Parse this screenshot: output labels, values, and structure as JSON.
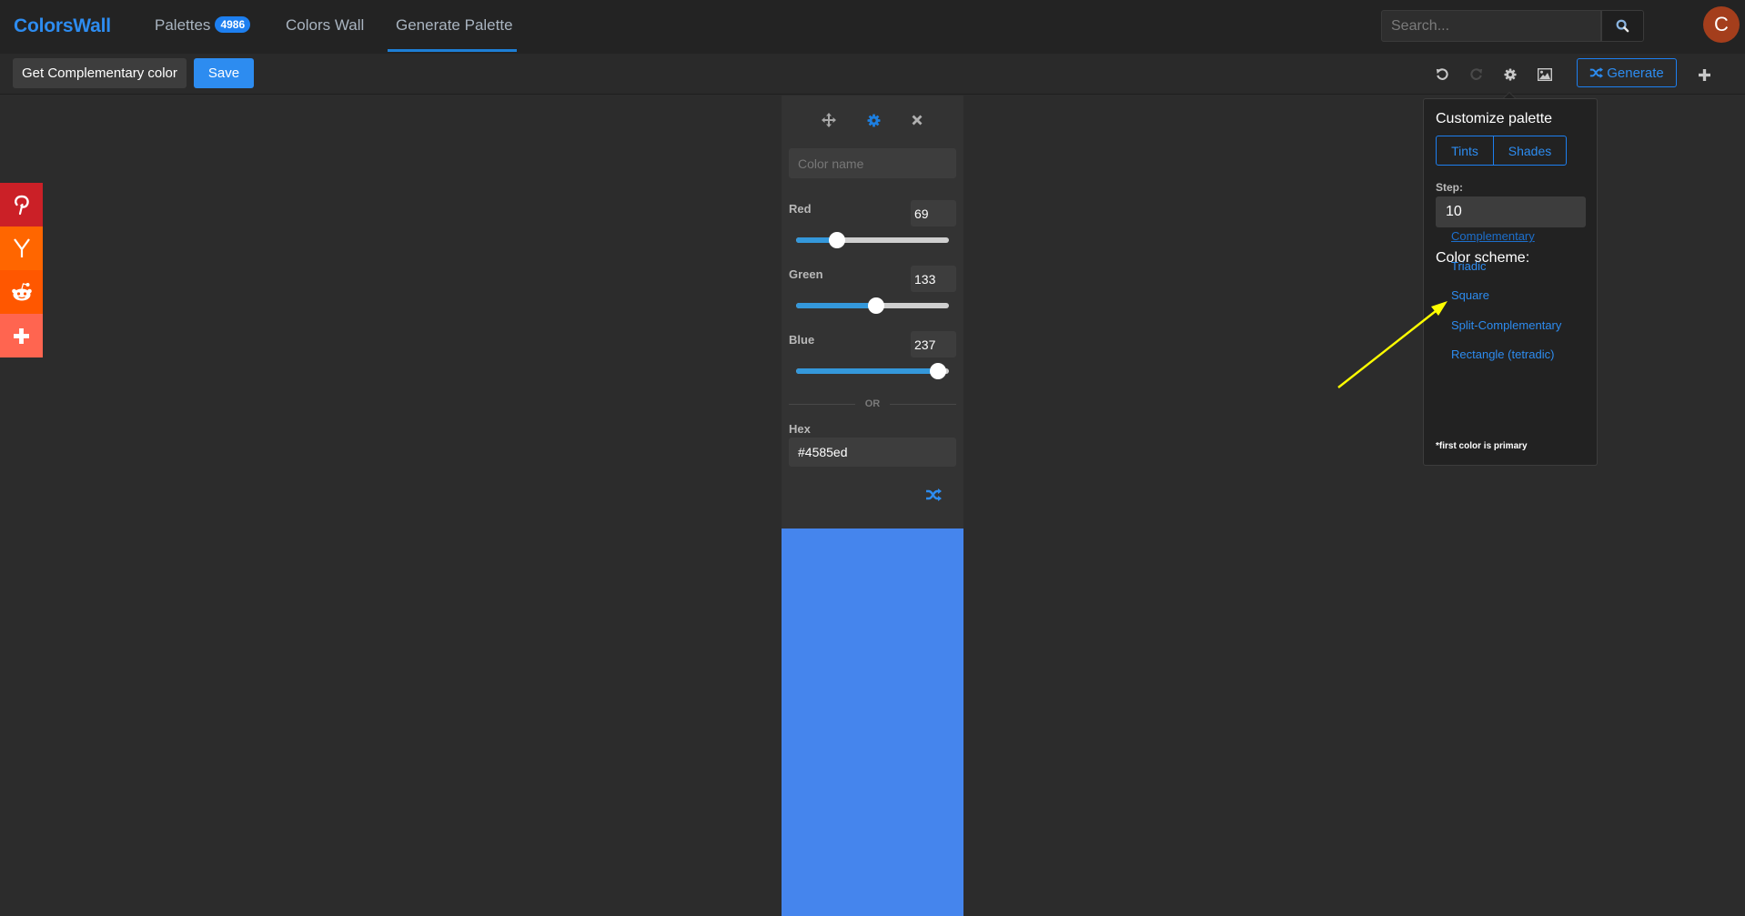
{
  "header": {
    "brand": "ColorsWall",
    "nav": [
      {
        "label": "Palettes",
        "badge": "4986"
      },
      {
        "label": "Colors Wall"
      },
      {
        "label": "Generate Palette",
        "active": true
      }
    ],
    "search": {
      "placeholder": "Search...",
      "value": ""
    },
    "avatar_initial": "C"
  },
  "toolbar": {
    "palette_name": "Get Complementary color",
    "save_label": "Save",
    "icons": [
      "undo-icon",
      "redo-icon",
      "settings-gear-icon",
      "image-icon"
    ],
    "generate_label": "Generate",
    "add_icon": "plus-icon"
  },
  "social": [
    {
      "name": "pinterest",
      "color": "#cb2027"
    },
    {
      "name": "hacker-news",
      "color": "#ff6600"
    },
    {
      "name": "reddit",
      "color": "#ff5700"
    },
    {
      "name": "more",
      "color": "#ff6550"
    }
  ],
  "color_panel": {
    "color_name_placeholder": "Color name",
    "color_name_value": "",
    "channels": [
      {
        "label": "Red",
        "value": "69",
        "fraction": 0.2706
      },
      {
        "label": "Green",
        "value": "133",
        "fraction": 0.5216
      },
      {
        "label": "Blue",
        "value": "237",
        "fraction": 0.9294
      }
    ],
    "or_label": "OR",
    "hex_label": "Hex",
    "hex_value": "#4585ed",
    "swatch_color": "#4585ed"
  },
  "popover": {
    "title": "Customize palette",
    "tints_label": "Tints",
    "shades_label": "Shades",
    "step_label": "Step:",
    "step_value": "10",
    "scheme_title": "Color scheme:",
    "schemes": [
      {
        "label": "Complementary",
        "active": true
      },
      {
        "label": "Triadic"
      },
      {
        "label": "Square"
      },
      {
        "label": "Split-Complementary"
      },
      {
        "label": "Rectangle (tetradic)"
      }
    ],
    "footnote": "*first color is primary"
  },
  "colors": {
    "accent": "#2d8cf0",
    "annotation_arrow": "#ffff00"
  }
}
